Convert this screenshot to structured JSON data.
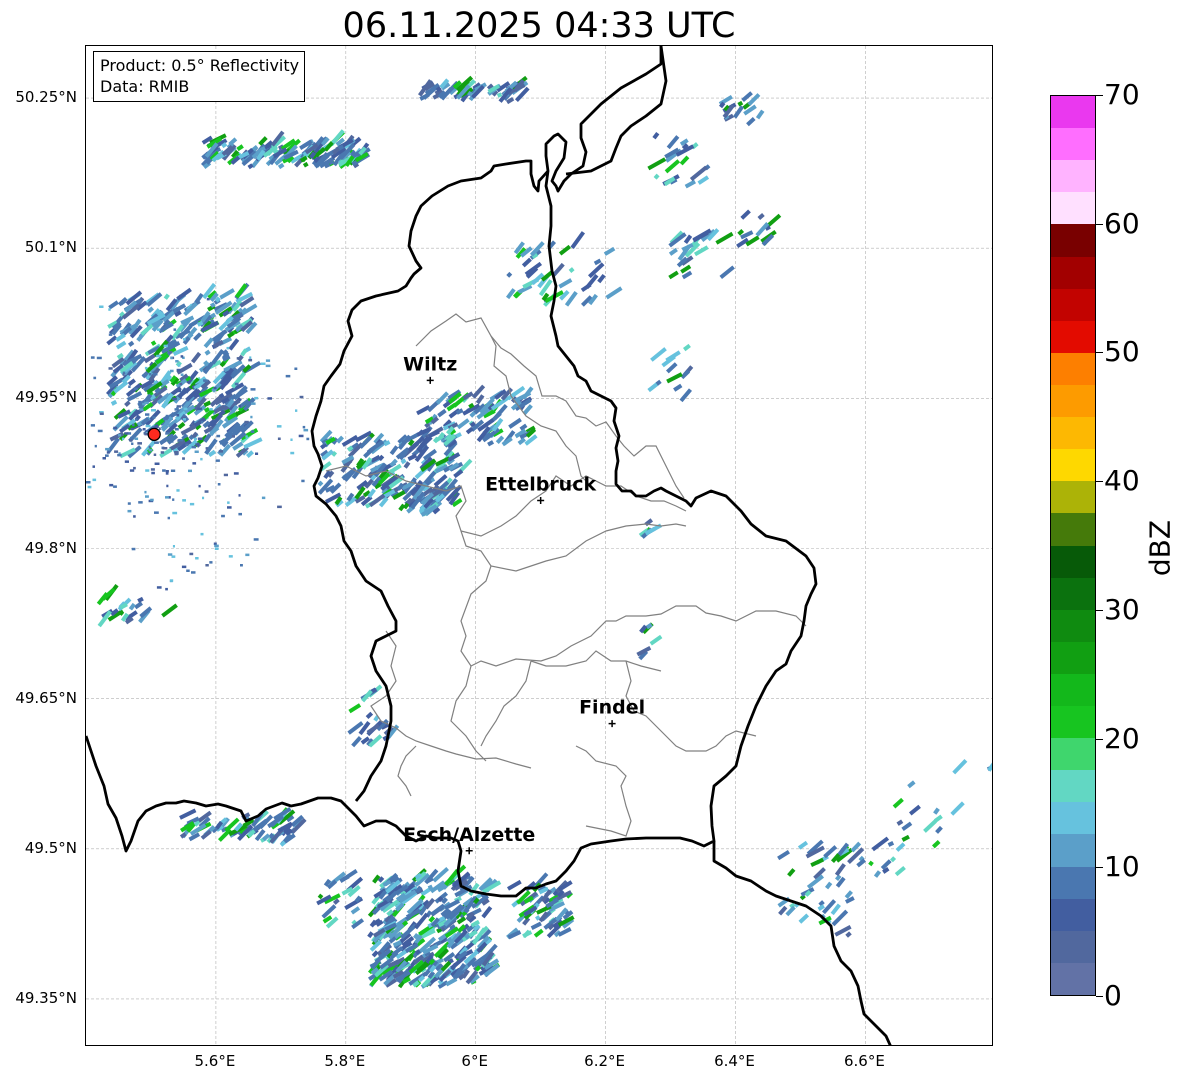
{
  "title": "06.11.2025 04:33 UTC",
  "info_box": {
    "line1": "Product: 0.5° Reflectivity",
    "line2": "Data: RMIB"
  },
  "map": {
    "lon_ticks": [
      {
        "value": 5.6,
        "label": "5.6°E"
      },
      {
        "value": 5.8,
        "label": "5.8°E"
      },
      {
        "value": 6.0,
        "label": "6°E"
      },
      {
        "value": 6.2,
        "label": "6.2°E"
      },
      {
        "value": 6.4,
        "label": "6.4°E"
      },
      {
        "value": 6.6,
        "label": "6.6°E"
      }
    ],
    "lat_ticks": [
      {
        "value": 50.25,
        "label": "50.25°N"
      },
      {
        "value": 50.1,
        "label": "50.1°N"
      },
      {
        "value": 49.95,
        "label": "49.95°N"
      },
      {
        "value": 49.8,
        "label": "49.8°N"
      },
      {
        "value": 49.65,
        "label": "49.65°N"
      },
      {
        "value": 49.5,
        "label": "49.5°N"
      },
      {
        "value": 49.35,
        "label": "49.35°N"
      }
    ],
    "cities": [
      {
        "name": "Wiltz",
        "lon": 5.93,
        "lat": 49.968
      },
      {
        "name": "Ettelbruck",
        "lon": 6.1,
        "lat": 49.848
      },
      {
        "name": "Findel",
        "lon": 6.21,
        "lat": 49.625
      },
      {
        "name": "Esch/Alzette",
        "lon": 5.99,
        "lat": 49.498
      }
    ],
    "radar_site": {
      "lon": 5.505,
      "lat": 49.914,
      "color": "#ff2a1f"
    },
    "grid": true
  },
  "colorbar": {
    "label": "dBZ",
    "min": 0,
    "max": 70,
    "ticks": [
      "0",
      "10",
      "20",
      "30",
      "40",
      "50",
      "60",
      "70"
    ],
    "colors": [
      "#6272a6",
      "#51689e",
      "#425ea0",
      "#4a77b0",
      "#5b9fc9",
      "#66c2de",
      "#62d7c3",
      "#3fd66d",
      "#17c520",
      "#13b81b",
      "#119f12",
      "#0f8b10",
      "#0b720e",
      "#075a08",
      "#457a0a",
      "#acb307",
      "#fed800",
      "#fdb802",
      "#fd9b00",
      "#fd7f00",
      "#e30b00",
      "#c20300",
      "#a20000",
      "#790000",
      "#ffe0ff",
      "#ffb3ff",
      "#ff6eff",
      "#ea38ef"
    ]
  }
}
